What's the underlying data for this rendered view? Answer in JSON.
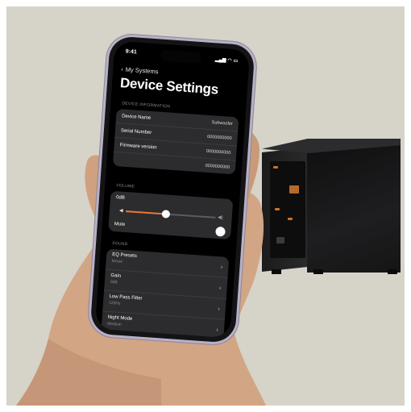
{
  "status_bar": {
    "time": "9:41"
  },
  "nav": {
    "back_label": "My Systems",
    "title": "Device Settings"
  },
  "device_information": {
    "header": "DEVICE INFORMATION",
    "rows": [
      {
        "label": "Device Name",
        "value": "Subwoofer"
      },
      {
        "label": "Serial Number",
        "value": "0000000000"
      },
      {
        "label": "Firmware version",
        "value": "0000000000"
      },
      {
        "label": "",
        "value": "0000000000"
      }
    ]
  },
  "volume": {
    "header": "VOLUME",
    "level_label": "0dB",
    "level_fraction": 0.45,
    "mute_label": "Mute"
  },
  "sound": {
    "header": "SOUND",
    "items": [
      {
        "title": "EQ Presets",
        "subtitle": "Movie"
      },
      {
        "title": "Gain",
        "subtitle": "0dB"
      },
      {
        "title": "Low Pass Filter",
        "subtitle": "120Hz"
      },
      {
        "title": "Night Mode",
        "subtitle": "Medium"
      }
    ]
  },
  "colors": {
    "accent": "#e8782c",
    "backdrop": "#d6d3c9",
    "screen": "#000000",
    "group": "#2c2c2e"
  }
}
